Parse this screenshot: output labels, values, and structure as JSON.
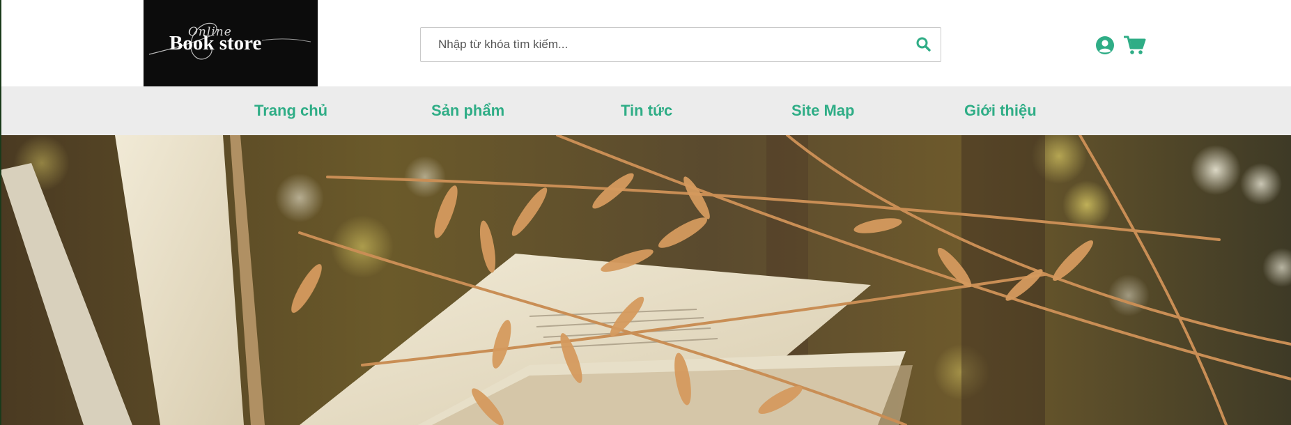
{
  "brand": {
    "script_text": "Online",
    "name": "Book store"
  },
  "search": {
    "placeholder": "Nhập từ khóa tìm kiếm...",
    "value": ""
  },
  "nav": {
    "items": [
      {
        "label": "Trang chủ"
      },
      {
        "label": "Sản phẩm"
      },
      {
        "label": "Tin tức"
      },
      {
        "label": "Site Map"
      },
      {
        "label": "Giới thiệu"
      }
    ]
  },
  "icons": {
    "search": "search-icon",
    "user": "user-circle-icon",
    "cart": "shopping-cart-icon"
  },
  "colors": {
    "accent": "#2fad86",
    "nav_background": "#ececec",
    "logo_background": "#0c0c0c"
  },
  "hero": {
    "image": "open book among dried oat grass with bokeh background"
  }
}
